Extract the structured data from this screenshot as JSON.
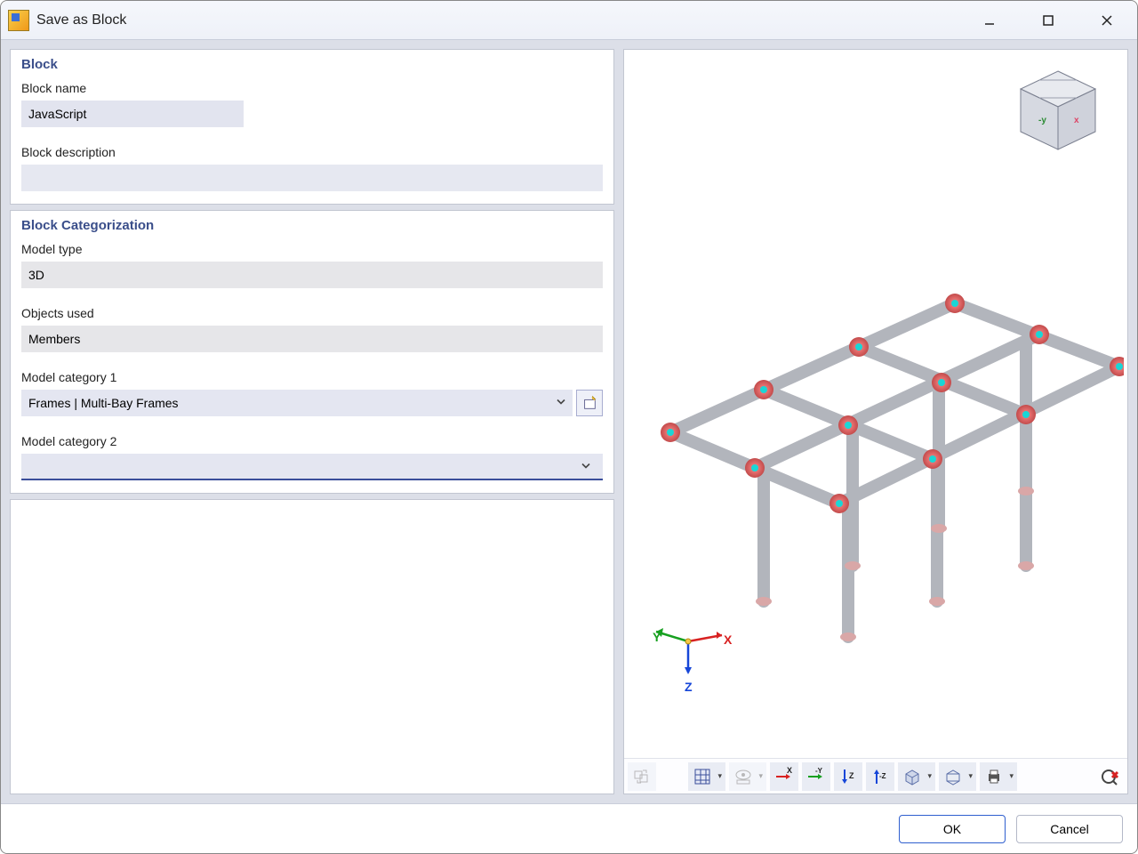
{
  "window": {
    "title": "Save as Block"
  },
  "panels": {
    "block": {
      "title": "Block",
      "name_label": "Block name",
      "name_value": "JavaScript",
      "desc_label": "Block description",
      "desc_value": ""
    },
    "categorization": {
      "title": "Block Categorization",
      "model_type_label": "Model type",
      "model_type_value": "3D",
      "objects_label": "Objects used",
      "objects_value": "Members",
      "cat1_label": "Model category 1",
      "cat1_value": "Frames | Multi-Bay Frames",
      "cat2_label": "Model category 2",
      "cat2_value": ""
    }
  },
  "axes": {
    "x": "X",
    "y": "Y",
    "z": "Z"
  },
  "toolbar_icons": [
    {
      "name": "swap-view-icon",
      "interact": false
    },
    {
      "name": "grid-dropdown-icon",
      "interact": true,
      "split": true
    },
    {
      "name": "visibility-icon",
      "interact": false,
      "split": true
    },
    {
      "name": "axis-x-icon",
      "interact": true,
      "letter": "X",
      "color": "#d82222",
      "arrow": "→"
    },
    {
      "name": "axis-neg-y-icon",
      "interact": true,
      "letter": "-Y",
      "color": "#17a020",
      "arrow": "→"
    },
    {
      "name": "axis-z-icon",
      "interact": true,
      "letter": "Z",
      "color": "#1646d8",
      "arrow": "↓"
    },
    {
      "name": "axis-neg-z-icon",
      "interact": true,
      "letter": "-Z",
      "color": "#1646d8",
      "arrow": "↑"
    },
    {
      "name": "solid-view-icon",
      "interact": true,
      "split": true
    },
    {
      "name": "wire-view-icon",
      "interact": true,
      "split": true
    },
    {
      "name": "print-icon",
      "interact": true,
      "split": true
    },
    {
      "name": "red-cross-icon",
      "interact": true
    }
  ],
  "footer": {
    "ok": "OK",
    "cancel": "Cancel"
  }
}
